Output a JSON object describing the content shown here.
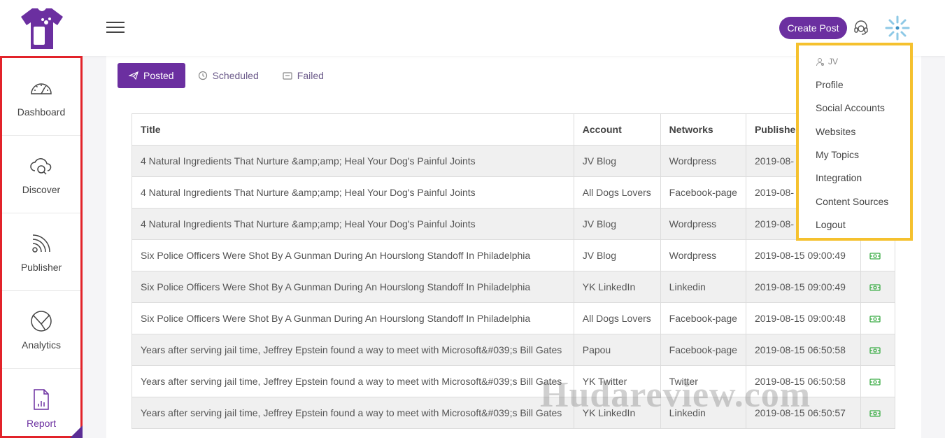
{
  "header": {
    "create_post_label": "Create Post",
    "brand_color": "#6b2fa0"
  },
  "sidebar": {
    "items": [
      {
        "label": "Dashboard",
        "icon": "speedometer-icon"
      },
      {
        "label": "Discover",
        "icon": "cloud-search-icon"
      },
      {
        "label": "Publisher",
        "icon": "rss-icon"
      },
      {
        "label": "Analytics",
        "icon": "chart-circle-icon"
      },
      {
        "label": "Report",
        "icon": "report-icon"
      }
    ]
  },
  "tabs": [
    {
      "label": "Posted",
      "active": true,
      "icon": "paper-plane-icon"
    },
    {
      "label": "Scheduled",
      "active": false,
      "icon": "clock-icon"
    },
    {
      "label": "Failed",
      "active": false,
      "icon": "alert-box-icon"
    }
  ],
  "table": {
    "headers": [
      "Title",
      "Account",
      "Networks",
      "Published"
    ],
    "rows": [
      {
        "title": "4 Natural Ingredients That Nurture &amp;amp; Heal Your Dog's Painful Joints",
        "account": "JV Blog",
        "network": "Wordpress",
        "published": "2019-08-"
      },
      {
        "title": "4 Natural Ingredients That Nurture &amp;amp; Heal Your Dog's Painful Joints",
        "account": "All Dogs Lovers",
        "network": "Facebook-page",
        "published": "2019-08-"
      },
      {
        "title": "4 Natural Ingredients That Nurture &amp;amp; Heal Your Dog's Painful Joints",
        "account": "JV Blog",
        "network": "Wordpress",
        "published": "2019-08-"
      },
      {
        "title": "Six Police Officers Were Shot By A Gunman During An Hourslong Standoff In Philadelphia",
        "account": "JV Blog",
        "network": "Wordpress",
        "published": "2019-08-15 09:00:49"
      },
      {
        "title": "Six Police Officers Were Shot By A Gunman During An Hourslong Standoff In Philadelphia",
        "account": "YK LinkedIn",
        "network": "Linkedin",
        "published": "2019-08-15 09:00:49"
      },
      {
        "title": "Six Police Officers Were Shot By A Gunman During An Hourslong Standoff In Philadelphia",
        "account": "All Dogs Lovers",
        "network": "Facebook-page",
        "published": "2019-08-15 09:00:48"
      },
      {
        "title": "Years after serving jail time, Jeffrey Epstein found a way to meet with Microsoft&#039;s Bill Gates",
        "account": "Papou",
        "network": "Facebook-page",
        "published": "2019-08-15 06:50:58"
      },
      {
        "title": "Years after serving jail time, Jeffrey Epstein found a way to meet with Microsoft&#039;s Bill Gates",
        "account": "YK Twitter",
        "network": "Twitter",
        "published": "2019-08-15 06:50:58"
      },
      {
        "title": "Years after serving jail time, Jeffrey Epstein found a way to meet with Microsoft&#039;s Bill Gates",
        "account": "YK LinkedIn",
        "network": "Linkedin",
        "published": "2019-08-15 06:50:57"
      }
    ]
  },
  "dropdown": {
    "user": "JV",
    "items": [
      "Profile",
      "Social Accounts",
      "Websites",
      "My Topics",
      "Integration",
      "Content Sources",
      "Logout"
    ]
  },
  "watermark": "Hudareview.com"
}
